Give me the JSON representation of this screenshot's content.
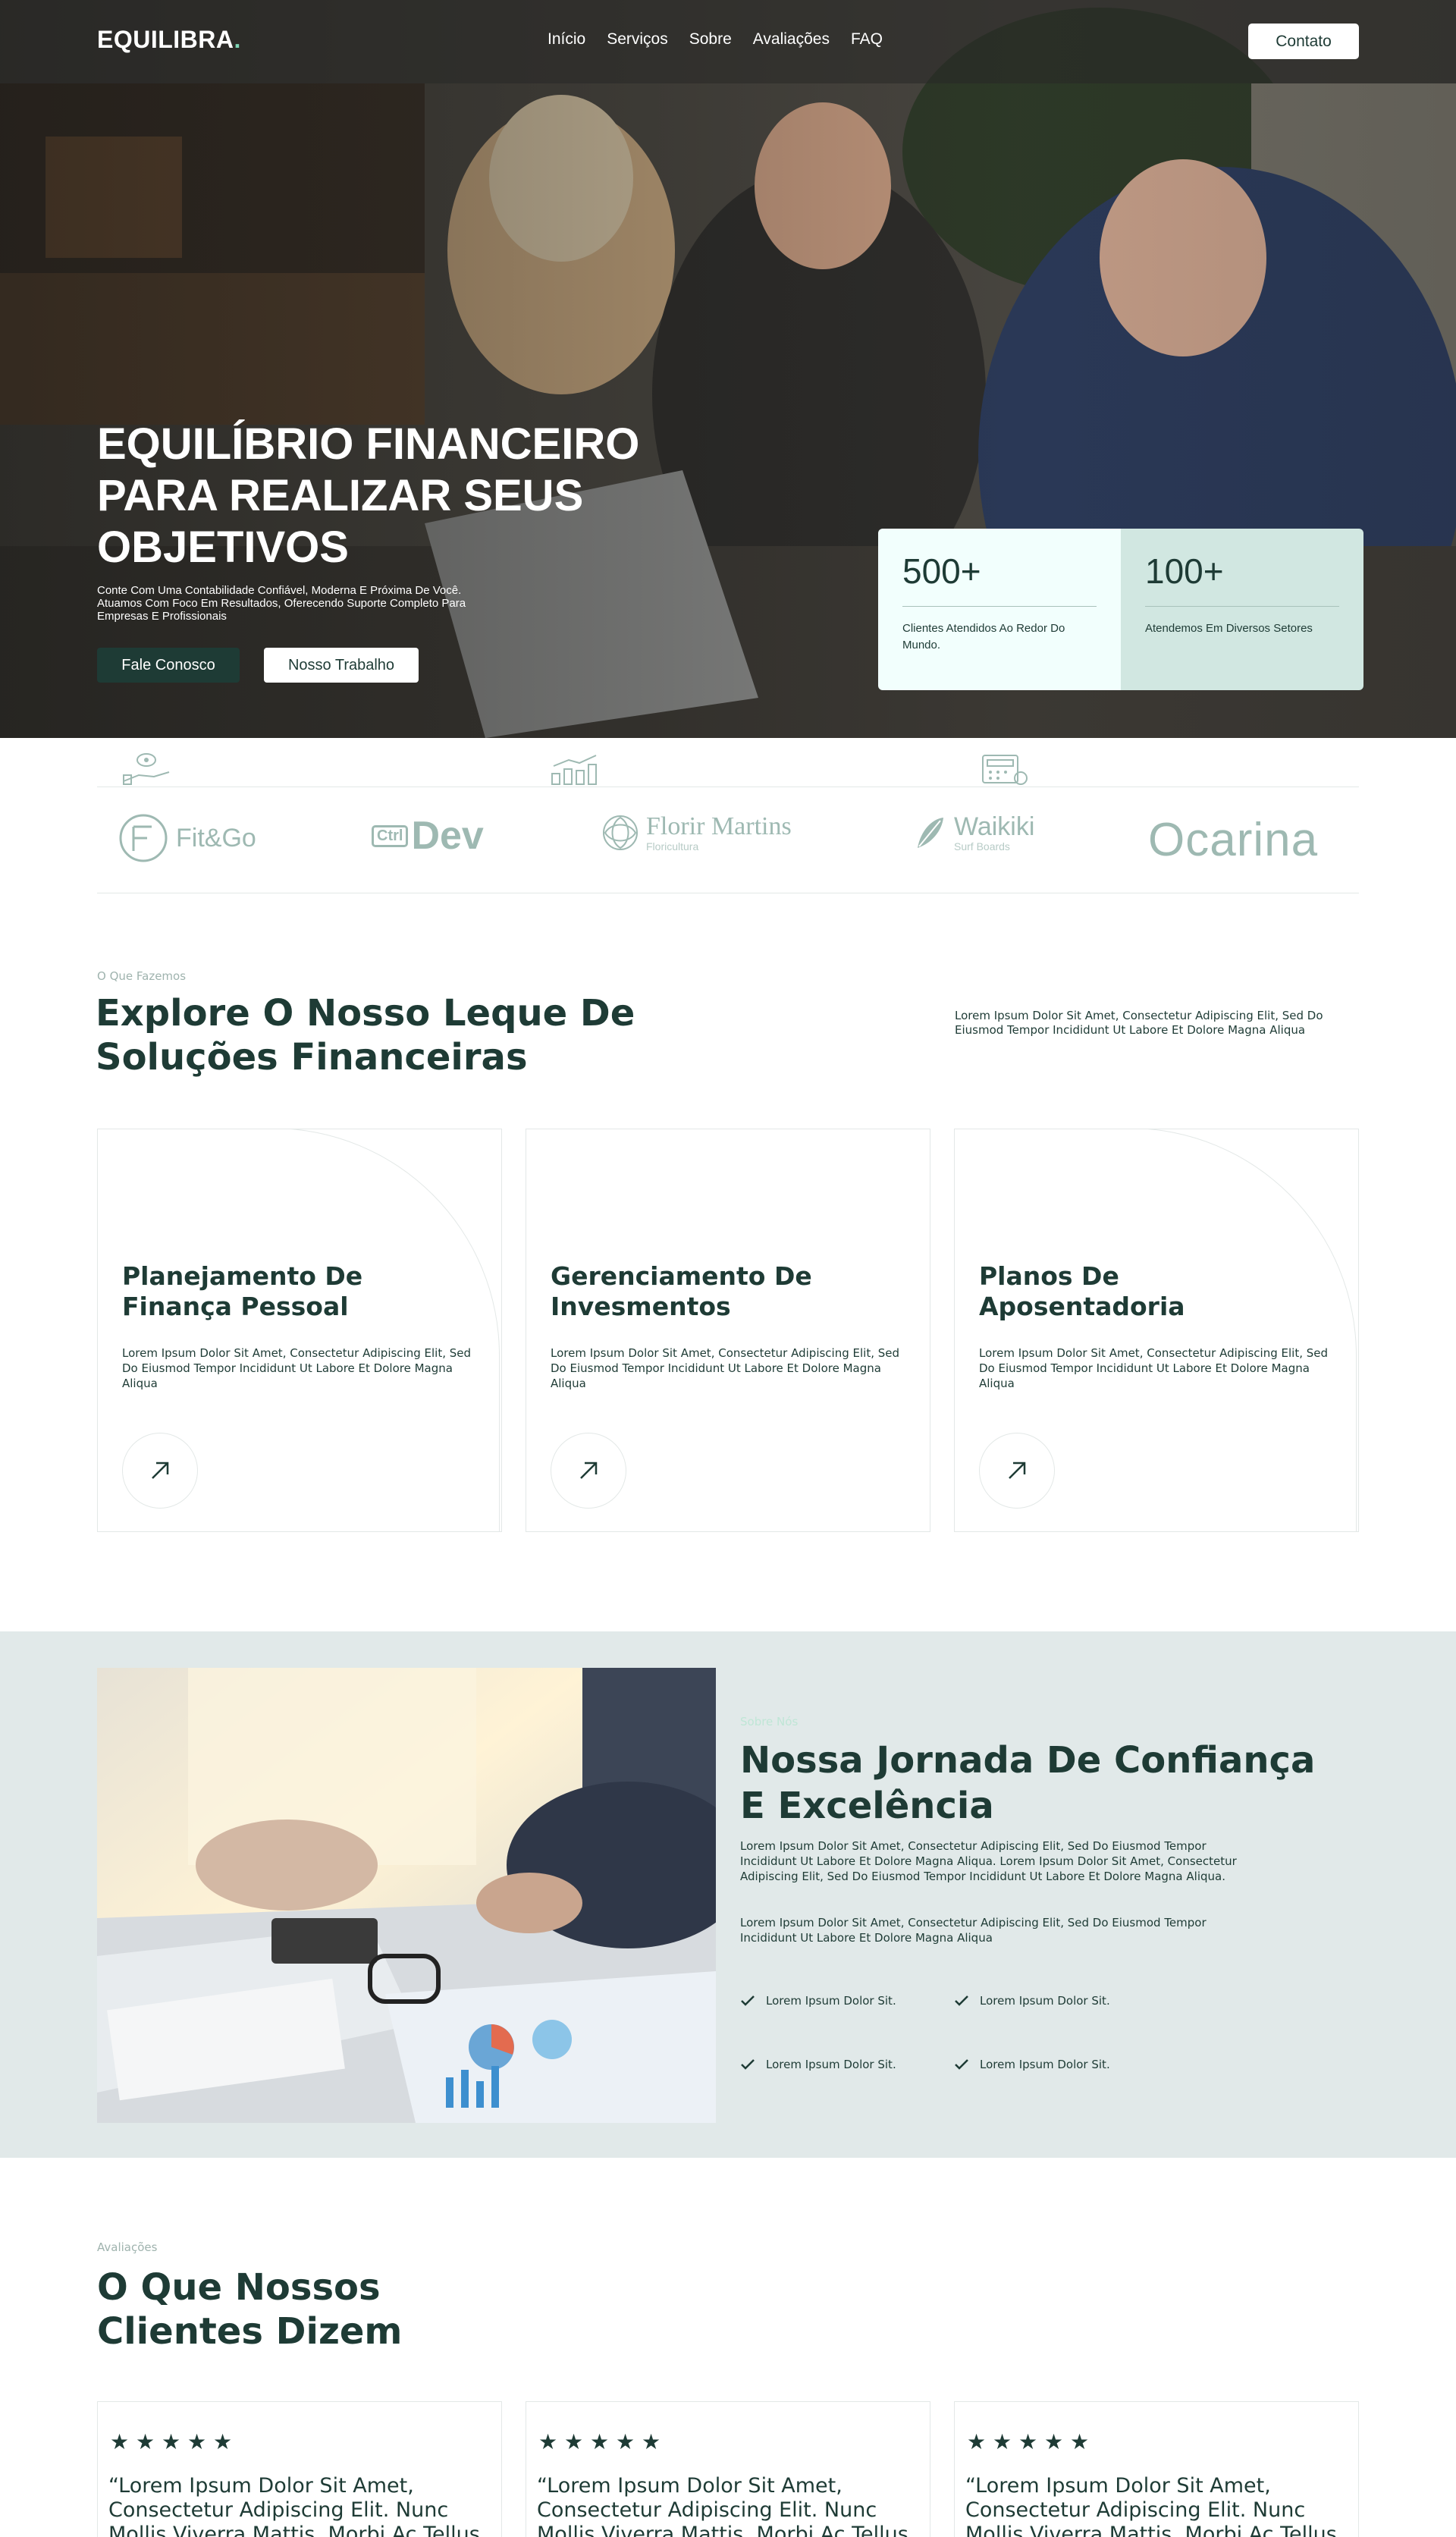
{
  "nav": {
    "logo": "EQUILIBRA",
    "logo_dot": ".",
    "links": [
      "Início",
      "Serviços",
      "Sobre",
      "Avaliações",
      "FAQ"
    ],
    "contact_label": "Contato"
  },
  "hero": {
    "title": "EQUILÍBRIO FINANCEIRO PARA REALIZAR SEUS OBJETIVOS",
    "subtitle": "Conte Com Uma Contabilidade Confiável, Moderna E Próxima De Você. Atuamos Com Foco Em Resultados, Oferecendo Suporte Completo Para Empresas E Profissionais",
    "primary_button": "Fale Conosco",
    "secondary_button": "Nosso Trabalho",
    "stats": [
      {
        "number": "500+",
        "label": "Clientes Atendidos Ao Redor Do Mundo."
      },
      {
        "number": "100+",
        "label": "Atendemos Em Diversos Setores"
      }
    ]
  },
  "logos": {
    "brands": [
      {
        "name": "Fit&Go"
      },
      {
        "name": "Dev",
        "badge": "Ctrl"
      },
      {
        "name": "Florir Martins",
        "sub": "Floricultura"
      },
      {
        "name": "Waikiki",
        "sub": "Surf Boards"
      },
      {
        "name": "Ocarina"
      }
    ]
  },
  "services": {
    "eyebrow": "O Que Fazemos",
    "title": "Explore O Nosso Leque De Soluções Financeiras",
    "side_text": "Lorem Ipsum Dolor Sit Amet, Consectetur Adipiscing Elit, Sed Do Eiusmod Tempor Incididunt Ut Labore Et Dolore Magna Aliqua",
    "cards": [
      {
        "title": "Planejamento De Finança Pessoal",
        "text": "Lorem Ipsum Dolor Sit Amet, Consectetur Adipiscing Elit, Sed Do Eiusmod Tempor Incididunt Ut Labore Et Dolore Magna Aliqua"
      },
      {
        "title": "Gerenciamento De Invesmentos",
        "text": "Lorem Ipsum Dolor Sit Amet, Consectetur Adipiscing Elit, Sed Do Eiusmod Tempor Incididunt Ut Labore Et Dolore Magna Aliqua"
      },
      {
        "title": "Planos De Aposentadoria",
        "text": "Lorem Ipsum Dolor Sit Amet, Consectetur Adipiscing Elit, Sed Do Eiusmod Tempor Incididunt Ut Labore Et Dolore Magna Aliqua"
      }
    ]
  },
  "journey": {
    "eyebrow": "Sobre Nós",
    "title": "Nossa Jornada De Confiança E Excelência",
    "paragraph1": "Lorem Ipsum Dolor Sit Amet, Consectetur Adipiscing Elit, Sed Do Eiusmod Tempor Incididunt Ut Labore Et Dolore Magna Aliqua. Lorem Ipsum Dolor Sit Amet, Consectetur Adipiscing Elit, Sed Do Eiusmod Tempor Incididunt Ut Labore Et Dolore Magna Aliqua.",
    "paragraph2": "Lorem Ipsum Dolor Sit Amet, Consectetur Adipiscing Elit, Sed Do Eiusmod Tempor Incididunt Ut Labore Et Dolore Magna Aliqua",
    "checks": [
      "Lorem Ipsum Dolor Sit.",
      "Lorem Ipsum Dolor Sit.",
      "Lorem Ipsum Dolor Sit.",
      "Lorem Ipsum Dolor Sit."
    ]
  },
  "testimonials": {
    "eyebrow": "Avaliações",
    "title": "O Que Nossos Clientes Dizem",
    "cards": [
      {
        "stars": "★ ★ ★ ★ ★",
        "rating": 5,
        "quote": "“Lorem Ipsum Dolor Sit Amet, Consectetur Adipiscing Elit. Nunc Mollis Viverra Mattis. Morbi Ac Tellus Sagittis,"
      },
      {
        "stars": "★ ★ ★ ★ ★",
        "rating": 5,
        "quote": "“Lorem Ipsum Dolor Sit Amet, Consectetur Adipiscing Elit. Nunc Mollis Viverra Mattis. Morbi Ac Tellus Sagittis,"
      },
      {
        "stars": "★ ★ ★ ★ ★",
        "rating": 5,
        "quote": "“Lorem Ipsum Dolor Sit Amet, Consectetur Adipiscing Elit. Nunc Mollis Viverra Mattis. Morbi Ac Tellus Sagittis,"
      }
    ]
  },
  "colors": {
    "primary": "#1e3b35",
    "accent": "#7ed6b6",
    "stat_light": "#f2fffd",
    "stat_mint": "#d1e7e1",
    "section_bg": "#e1e9e9",
    "muted": "#9fb3ae"
  },
  "icons": {
    "card_arrow": "arrow-up-right-icon",
    "check": "check-icon",
    "star": "star-icon"
  }
}
